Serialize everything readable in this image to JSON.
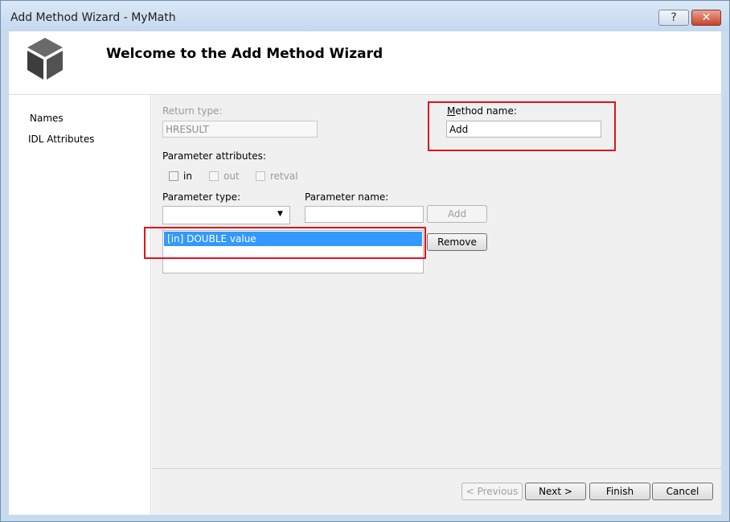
{
  "window": {
    "title": "Add Method Wizard - MyMath",
    "help_label": "?",
    "close_label": "✕"
  },
  "header": {
    "title": "Welcome to the Add Method Wizard",
    "logo_icon": "cube-icon"
  },
  "nav": {
    "items": [
      {
        "label": "Names"
      },
      {
        "label": "IDL Attributes"
      }
    ]
  },
  "form": {
    "return_type_label": "Return type:",
    "return_type_value": "HRESULT",
    "method_name_label_u": "M",
    "method_name_label_rest": "ethod name:",
    "method_name_value": "Add",
    "param_attributes_label": "Parameter attributes:",
    "attr_in_label": "in",
    "attr_out_label": "out",
    "attr_retval_label": "retval",
    "param_type_label": "Parameter type:",
    "param_type_value": "",
    "param_name_label": "Parameter name:",
    "param_name_value": "",
    "add_label": "Add",
    "remove_label": "Remove",
    "parameters": [
      "[in] DOUBLE value"
    ]
  },
  "footer": {
    "previous_label": "< Previous",
    "next_label": "Next >",
    "finish_label": "Finish",
    "cancel_label": "Cancel"
  },
  "colors": {
    "selection": "#3399ff",
    "highlight_box": "#e0141b"
  }
}
